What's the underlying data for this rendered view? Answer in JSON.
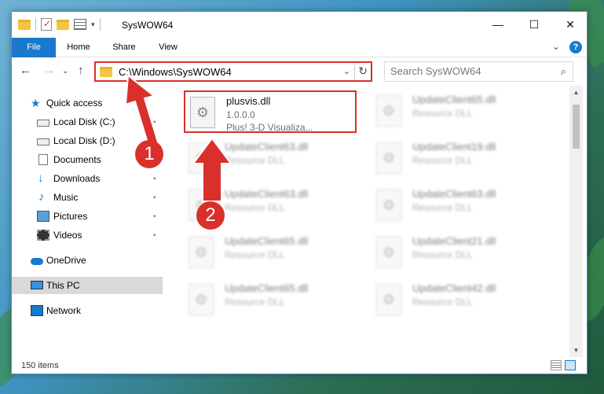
{
  "window": {
    "title": "SysWOW64",
    "controls": {
      "minimize": "—",
      "maximize": "☐",
      "close": "✕"
    }
  },
  "ribbon": {
    "tabs": [
      "File",
      "Home",
      "Share",
      "View"
    ],
    "expand_icon": "⌄",
    "help_icon": "?"
  },
  "navigation": {
    "back_icon": "←",
    "forward_icon": "→",
    "recent_icon": "⌄",
    "up_icon": "↑",
    "address_path": "C:\\Windows\\SysWOW64",
    "address_dropdown_icon": "⌄",
    "refresh_icon": "↻",
    "search_placeholder": "Search SysWOW64",
    "search_icon": "⌕"
  },
  "sidebar": {
    "items": [
      {
        "label": "Quick access",
        "icon": "star-icon",
        "pinned": false,
        "selected": false
      },
      {
        "label": "Local Disk (C:)",
        "icon": "disk-icon",
        "pinned": true,
        "selected": false
      },
      {
        "label": "Local Disk (D:)",
        "icon": "disk-icon",
        "pinned": true,
        "selected": false
      },
      {
        "label": "Documents",
        "icon": "documents-icon",
        "pinned": true,
        "selected": false
      },
      {
        "label": "Downloads",
        "icon": "download-icon",
        "pinned": true,
        "selected": false
      },
      {
        "label": "Music",
        "icon": "music-icon",
        "pinned": true,
        "selected": false
      },
      {
        "label": "Pictures",
        "icon": "pictures-icon",
        "pinned": true,
        "selected": false
      },
      {
        "label": "Videos",
        "icon": "videos-icon",
        "pinned": true,
        "selected": false
      },
      {
        "label": "OneDrive",
        "icon": "onedrive-icon",
        "pinned": false,
        "selected": false
      },
      {
        "label": "This PC",
        "icon": "this-pc-icon",
        "pinned": false,
        "selected": true
      },
      {
        "label": "Network",
        "icon": "network-icon",
        "pinned": false,
        "selected": false
      }
    ],
    "pin_glyph": "📌"
  },
  "files": [
    {
      "name": "plusvis.dll",
      "version": "1.0.0.0",
      "description": "Plus! 3-D Visualiza...",
      "highlighted": true,
      "blurred": false
    },
    {
      "name": "UpdateClient65.dll",
      "version": "",
      "description": "Resource DLL",
      "highlighted": false,
      "blurred": true
    },
    {
      "name": "UpdateClient63.dll",
      "version": "",
      "description": "Resource DLL",
      "highlighted": false,
      "blurred": true
    },
    {
      "name": "UpdateClient19.dll",
      "version": "",
      "description": "Resource DLL",
      "highlighted": false,
      "blurred": true
    },
    {
      "name": "UpdateClient63.dll",
      "version": "",
      "description": "Resource DLL",
      "highlighted": false,
      "blurred": true
    },
    {
      "name": "UpdateClient63.dll",
      "version": "",
      "description": "Resource DLL",
      "highlighted": false,
      "blurred": true
    },
    {
      "name": "UpdateClient65.dll",
      "version": "",
      "description": "Resource DLL",
      "highlighted": false,
      "blurred": true
    },
    {
      "name": "UpdateClient21.dll",
      "version": "",
      "description": "Resource DLL",
      "highlighted": false,
      "blurred": true
    },
    {
      "name": "UpdateClient65.dll",
      "version": "",
      "description": "Resource DLL",
      "highlighted": false,
      "blurred": true
    },
    {
      "name": "UpdateClient42.dll",
      "version": "",
      "description": "Resource DLL",
      "highlighted": false,
      "blurred": true
    }
  ],
  "status": {
    "item_count": "150 items"
  },
  "annotations": {
    "callout_1": "1",
    "callout_2": "2",
    "accent_color": "#d9302b"
  },
  "colors": {
    "accent_blue": "#1979ca",
    "highlight_red": "#d9302b",
    "selected_bg": "#d9d9d9"
  }
}
